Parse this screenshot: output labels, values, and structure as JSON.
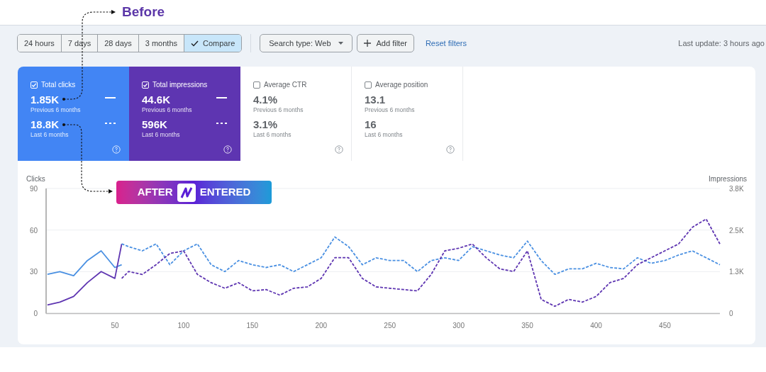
{
  "annotations": {
    "before": "Before",
    "after_left": "AFTER",
    "after_right": "ENTERED"
  },
  "periods": [
    {
      "label": "24 hours",
      "selected": false
    },
    {
      "label": "7 days",
      "selected": false
    },
    {
      "label": "28 days",
      "selected": false
    },
    {
      "label": "3 months",
      "selected": false
    },
    {
      "label": "Compare",
      "selected": true
    }
  ],
  "search_type": "Search type: Web",
  "add_filter": "Add filter",
  "reset_filters": "Reset filters",
  "last_update": "Last update: 3 hours ago",
  "metrics": [
    {
      "label": "Total clicks",
      "checked": true,
      "color": "#4285f4",
      "previous": {
        "value": "1.85K",
        "label": "Previous 6 months"
      },
      "last": {
        "value": "18.8K",
        "label": "Last 6 months"
      }
    },
    {
      "label": "Total impressions",
      "checked": true,
      "color": "#5e35b1",
      "previous": {
        "value": "44.6K",
        "label": "Previous 6 months"
      },
      "last": {
        "value": "596K",
        "label": "Last 6 months"
      }
    },
    {
      "label": "Average CTR",
      "checked": false,
      "previous": {
        "value": "4.1%",
        "label": "Previous 6 months"
      },
      "last": {
        "value": "3.1%",
        "label": "Last 6 months"
      }
    },
    {
      "label": "Average position",
      "checked": false,
      "previous": {
        "value": "13.1",
        "label": "Previous 6 months"
      },
      "last": {
        "value": "16",
        "label": "Last 6 months"
      }
    }
  ],
  "chart": {
    "chart_data": {
      "type": "line",
      "ylabel": "Clicks",
      "y2label": "Impressions",
      "xlim": [
        0,
        490
      ],
      "ylim": [
        0,
        90
      ],
      "y2lim": [
        0,
        3800
      ],
      "y2ticks": [
        {
          "value": 0,
          "label": "0"
        },
        {
          "value": 1267,
          "label": "1.3K"
        },
        {
          "value": 2533,
          "label": "2.5K"
        },
        {
          "value": 3800,
          "label": "3.8K"
        }
      ],
      "xticks": [
        50,
        100,
        150,
        200,
        250,
        300,
        350,
        400,
        450
      ],
      "yticks": [
        0,
        30,
        60,
        90
      ],
      "x": [
        1,
        10,
        20,
        30,
        40,
        50,
        55,
        60,
        70,
        80,
        90,
        100,
        110,
        120,
        130,
        140,
        150,
        160,
        170,
        180,
        190,
        200,
        210,
        220,
        230,
        240,
        250,
        260,
        270,
        280,
        290,
        300,
        310,
        320,
        330,
        340,
        350,
        360,
        370,
        380,
        390,
        400,
        410,
        420,
        430,
        440,
        450,
        460,
        470,
        480,
        490
      ],
      "series": [
        {
          "color": "#4a90e2",
          "values": [
            28,
            30,
            27,
            38,
            45,
            33,
            35,
            null,
            null,
            null,
            null,
            null,
            null,
            null,
            null,
            null,
            null,
            null,
            null,
            null,
            null,
            null,
            null,
            null,
            null,
            null,
            null,
            null,
            null,
            null,
            null,
            null,
            null,
            null,
            null,
            null,
            null,
            null,
            null,
            null,
            null,
            null,
            null,
            null,
            null,
            null,
            null,
            null,
            null,
            null,
            null
          ]
        },
        {
          "color": "#5e35b1",
          "axis": "y2",
          "values": [
            250,
            340,
            510,
            930,
            1270,
            1060,
            2110,
            null,
            null,
            null,
            null,
            null,
            null,
            null,
            null,
            null,
            null,
            null,
            null,
            null,
            null,
            null,
            null,
            null,
            null,
            null,
            null,
            null,
            null,
            null,
            null,
            null,
            null,
            null,
            null,
            null,
            null,
            null,
            null,
            null,
            null,
            null,
            null,
            null,
            null,
            null,
            null,
            null,
            null,
            null,
            null
          ]
        },
        {
          "color": "#4a90e2",
          "line_style": "dashed",
          "values": [
            null,
            null,
            null,
            null,
            null,
            null,
            50,
            48,
            45,
            50,
            35,
            45,
            50,
            35,
            30,
            38,
            35,
            33,
            35,
            30,
            35,
            40,
            55,
            48,
            35,
            40,
            38,
            38,
            30,
            38,
            40,
            38,
            48,
            45,
            42,
            40,
            52,
            38,
            28,
            32,
            32,
            36,
            33,
            32,
            40,
            36,
            38,
            42,
            45,
            40,
            35
          ]
        },
        {
          "color": "#5e35b1",
          "axis": "y2",
          "line_style": "dashed",
          "values": [
            null,
            null,
            null,
            null,
            null,
            null,
            1060,
            1270,
            1180,
            1480,
            1820,
            1900,
            1180,
            930,
            760,
            930,
            680,
            720,
            550,
            760,
            800,
            1060,
            1690,
            1690,
            1060,
            800,
            760,
            720,
            680,
            1180,
            1900,
            1980,
            2110,
            1690,
            1350,
            1270,
            1900,
            420,
            210,
            420,
            340,
            510,
            930,
            1060,
            1480,
            1690,
            1900,
            2110,
            2620,
            2870,
            2110
          ]
        }
      ]
    }
  }
}
